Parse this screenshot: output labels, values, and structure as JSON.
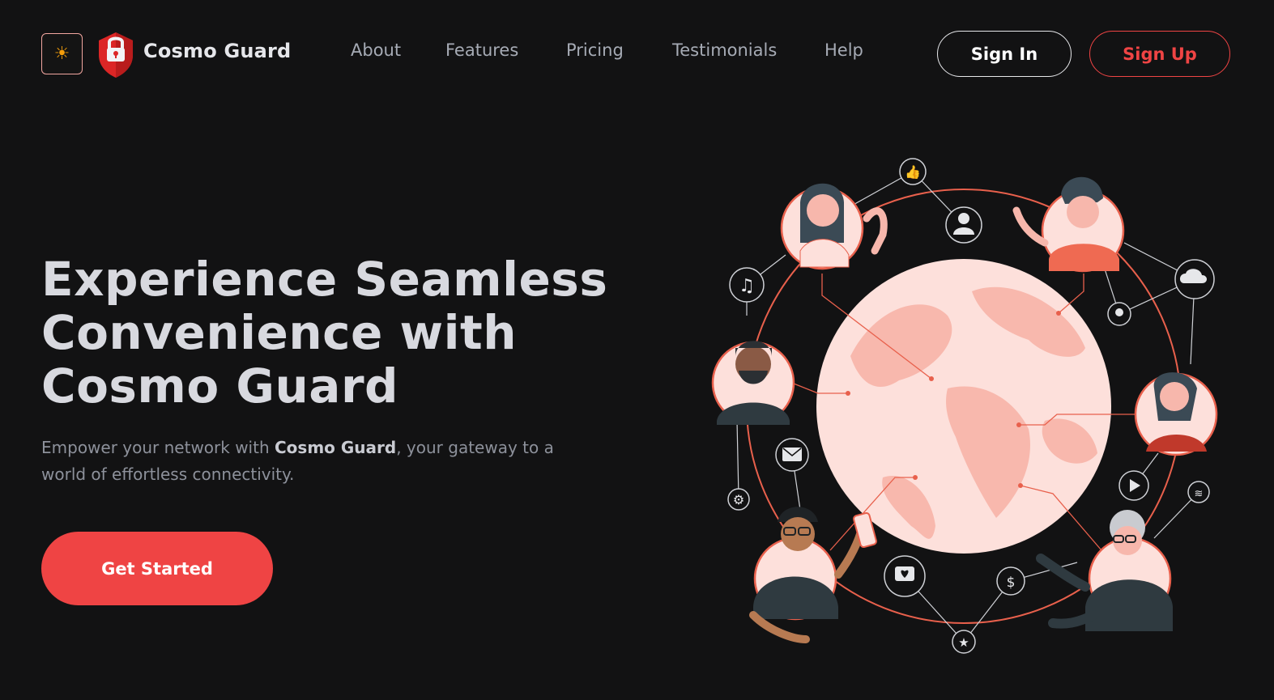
{
  "header": {
    "brand": "Cosmo Guard",
    "theme_icon": "sun-icon",
    "logo_icon": "shield-lock-icon"
  },
  "nav": {
    "items": [
      {
        "label": "About"
      },
      {
        "label": "Features"
      },
      {
        "label": "Pricing"
      },
      {
        "label": "Testimonials"
      },
      {
        "label": "Help"
      }
    ]
  },
  "auth": {
    "signin_label": "Sign In",
    "signup_label": "Sign Up"
  },
  "hero": {
    "title_line1": "Experience Seamless",
    "title_line2": "Convenience with",
    "title_line3": "Cosmo Guard",
    "sub_before": "Empower your network with ",
    "sub_bold": "Cosmo Guard",
    "sub_after": ", your gateway to a world of effortless connectivity.",
    "cta_label": "Get Started"
  },
  "colors": {
    "background": "#121213",
    "accent": "#ef4444",
    "text": "#d8d9df",
    "muted": "#8d919b",
    "globe": "#fcd5cf"
  }
}
